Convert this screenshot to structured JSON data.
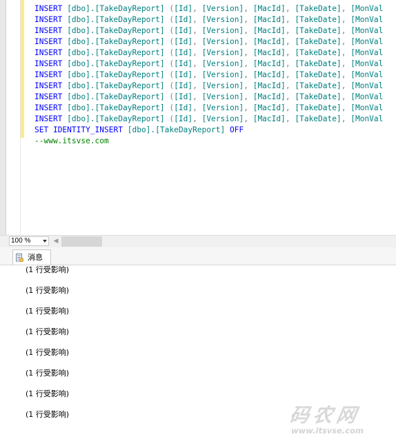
{
  "editor": {
    "insert_lines": [
      {
        "kw": "INSERT",
        "table": "[dbo].[TakeDayReport]",
        "cols": [
          "[Id]",
          "[Version]",
          "[MacId]",
          "[TakeDate]",
          "[MonVal"
        ]
      },
      {
        "kw": "INSERT",
        "table": "[dbo].[TakeDayReport]",
        "cols": [
          "[Id]",
          "[Version]",
          "[MacId]",
          "[TakeDate]",
          "[MonVal"
        ]
      },
      {
        "kw": "INSERT",
        "table": "[dbo].[TakeDayReport]",
        "cols": [
          "[Id]",
          "[Version]",
          "[MacId]",
          "[TakeDate]",
          "[MonVal"
        ]
      },
      {
        "kw": "INSERT",
        "table": "[dbo].[TakeDayReport]",
        "cols": [
          "[Id]",
          "[Version]",
          "[MacId]",
          "[TakeDate]",
          "[MonVal"
        ]
      },
      {
        "kw": "INSERT",
        "table": "[dbo].[TakeDayReport]",
        "cols": [
          "[Id]",
          "[Version]",
          "[MacId]",
          "[TakeDate]",
          "[MonVal"
        ]
      },
      {
        "kw": "INSERT",
        "table": "[dbo].[TakeDayReport]",
        "cols": [
          "[Id]",
          "[Version]",
          "[MacId]",
          "[TakeDate]",
          "[MonVal"
        ]
      },
      {
        "kw": "INSERT",
        "table": "[dbo].[TakeDayReport]",
        "cols": [
          "[Id]",
          "[Version]",
          "[MacId]",
          "[TakeDate]",
          "[MonVal"
        ]
      },
      {
        "kw": "INSERT",
        "table": "[dbo].[TakeDayReport]",
        "cols": [
          "[Id]",
          "[Version]",
          "[MacId]",
          "[TakeDate]",
          "[MonVal"
        ]
      },
      {
        "kw": "INSERT",
        "table": "[dbo].[TakeDayReport]",
        "cols": [
          "[Id]",
          "[Version]",
          "[MacId]",
          "[TakeDate]",
          "[MonVal"
        ]
      },
      {
        "kw": "INSERT",
        "table": "[dbo].[TakeDayReport]",
        "cols": [
          "[Id]",
          "[Version]",
          "[MacId]",
          "[TakeDate]",
          "[MonVal"
        ]
      },
      {
        "kw": "INSERT",
        "table": "[dbo].[TakeDayReport]",
        "cols": [
          "[Id]",
          "[Version]",
          "[MacId]",
          "[TakeDate]",
          "[MonVal"
        ]
      }
    ],
    "identity_line": {
      "kw1": "SET IDENTITY_INSERT",
      "table": "[dbo].[TakeDayReport]",
      "kw2": "OFF"
    },
    "comment_line": "--www.itsvse.com"
  },
  "status": {
    "zoom": "100 %"
  },
  "results": {
    "tab_label": "消息",
    "messages": [
      "(1 行受影响)",
      "(1 行受影响)",
      "(1 行受影响)",
      "(1 行受影响)",
      "(1 行受影响)",
      "(1 行受影响)",
      "(1 行受影响)",
      "(1 行受影响)"
    ]
  },
  "watermark": {
    "big": "码农网",
    "small": "www.itsvse.com"
  },
  "colors": {
    "keyword": "#0000ff",
    "identifier": "#008080",
    "punctuation": "#808080",
    "comment": "#008000"
  },
  "icons": {
    "tab_icon": "message-document-icon",
    "zoom_dropdown": "chevron-down-icon"
  }
}
